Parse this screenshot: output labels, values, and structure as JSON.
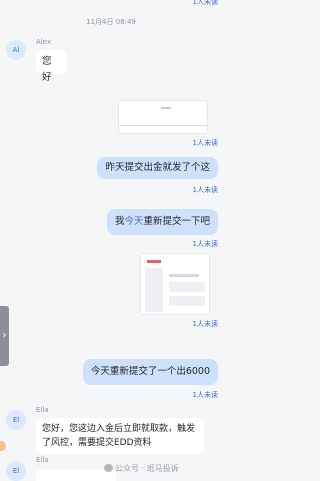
{
  "read_label": "1人未读",
  "time_separator": "11月4日 08:49",
  "messages": [
    {
      "avatar": "Al",
      "sender": "Alex",
      "text": "您好"
    },
    {
      "text": "昨天提交出金就发了个这"
    },
    {
      "text_before": "我",
      "highlight": "今天",
      "text_after": "重新提交一下吧"
    },
    {
      "text": "今天重新提交了一个出6000"
    },
    {
      "avatar": "El",
      "sender": "Ella",
      "text": "您好，您这边入金后立即就取款，触发了风控，需要提交EDD资料"
    },
    {
      "avatar": "El",
      "sender": "Ella"
    }
  ],
  "side_handle_glyph": "›",
  "watermark": "公众号 · 斑马投诉"
}
